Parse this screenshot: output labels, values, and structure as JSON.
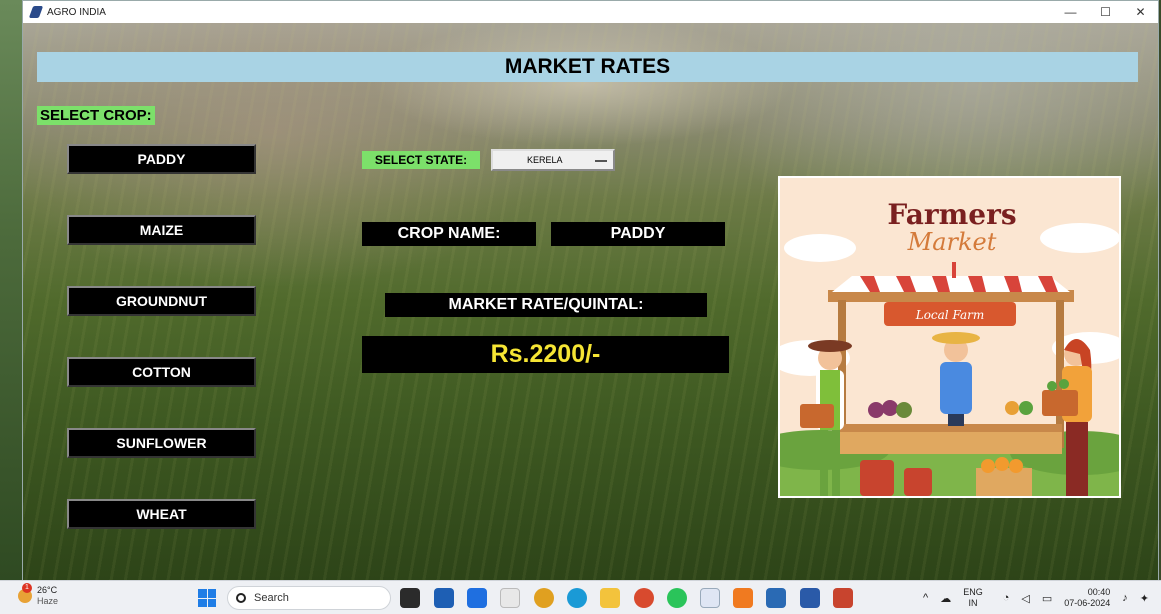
{
  "window": {
    "title": "AGRO INDIA",
    "controls": {
      "minimize": "—",
      "maximize": "☐",
      "close": "✕"
    }
  },
  "header": {
    "title": "MARKET RATES"
  },
  "crop_selector": {
    "label": "SELECT CROP:",
    "crops": [
      "PADDY",
      "MAIZE",
      "GROUNDNUT",
      "COTTON",
      "SUNFLOWER",
      "WHEAT"
    ]
  },
  "state_selector": {
    "label": "SELECT STATE:",
    "selected": "KERELA"
  },
  "result": {
    "crop_name_label": "CROP NAME:",
    "crop_name_value": "PADDY",
    "rate_label": "MARKET RATE/QUINTAL:",
    "rate_value": "Rs.2200/-"
  },
  "poster": {
    "title_line1": "Farmers",
    "title_line2": "Market",
    "sign": "Local Farm"
  },
  "taskbar": {
    "weather_temp": "26°C",
    "weather_desc": "Haze",
    "search_label": "Search",
    "lang_top": "ENG",
    "lang_bottom": "IN",
    "time": "00:40",
    "date": "07-06-2024",
    "tray_chevron": "^"
  },
  "colors": {
    "header_bg": "#a9d3e4",
    "label_green": "#7ce06a",
    "rate_yellow": "#f6e534",
    "button_black": "#000000"
  }
}
